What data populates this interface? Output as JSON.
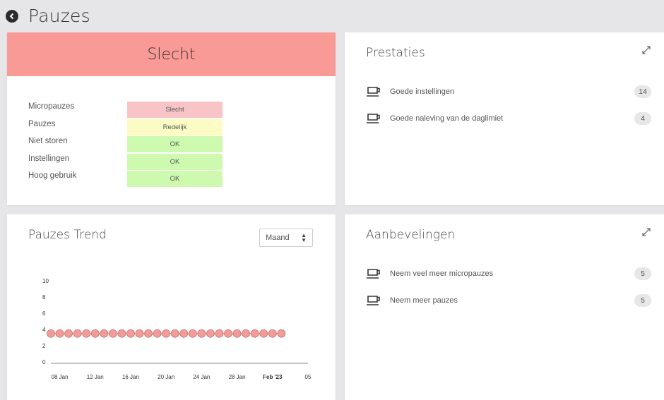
{
  "header": {
    "title": "Pauzes",
    "back_icon": "chevron-left-circle-icon"
  },
  "status": {
    "overall": "Slecht",
    "overall_color": "#f99a96",
    "rows": [
      {
        "label": "Micropauzes",
        "value": "Slecht",
        "color": "#f8c4c6"
      },
      {
        "label": "Pauzes",
        "value": "Redelijk",
        "color": "#fdfbc4"
      },
      {
        "label": "Niet storen",
        "value": "OK",
        "color": "#cefab0"
      },
      {
        "label": "Instellingen",
        "value": "OK",
        "color": "#cefab0"
      },
      {
        "label": "Hoog gebruik",
        "value": "OK",
        "color": "#cefab0"
      }
    ]
  },
  "achievements": {
    "title": "Prestaties",
    "items": [
      {
        "label": "Goede instellingen",
        "count": "14",
        "icon": "coffee-cup-icon"
      },
      {
        "label": "Goede naleving van de daglimiet",
        "count": "4",
        "icon": "coffee-cup-icon"
      }
    ]
  },
  "recommendations": {
    "title": "Aanbevelingen",
    "items": [
      {
        "label": "Neem veel meer micropauzes",
        "count": "5",
        "icon": "coffee-cup-icon"
      },
      {
        "label": "Neem meer pauzes",
        "count": "5",
        "icon": "coffee-cup-icon"
      }
    ]
  },
  "trend": {
    "title": "Pauzes Trend",
    "period_select": "Maand"
  },
  "chart_data": {
    "type": "line",
    "y_ticks": [
      "0",
      "2",
      "4",
      "6",
      "8",
      "10"
    ],
    "ylim": [
      0,
      10
    ],
    "x_tick_labels": [
      "08 Jan",
      "12 Jan",
      "16 Jan",
      "20 Jan",
      "24 Jan",
      "28 Jan",
      "Feb '23",
      "05"
    ],
    "bold_x_tick": "Feb '23",
    "x_start": "2023-01-07",
    "values": [
      3.5,
      3.5,
      3.5,
      3.5,
      3.5,
      3.5,
      3.5,
      3.5,
      3.5,
      3.5,
      3.5,
      3.5,
      3.5,
      3.5,
      3.5,
      3.5,
      3.5,
      3.5,
      3.5,
      3.5,
      3.5,
      3.5,
      3.5,
      3.5,
      3.5,
      3.5,
      3.5
    ],
    "point_color": "#f29b98",
    "point_stroke": "#c86e6b",
    "grid": false
  }
}
